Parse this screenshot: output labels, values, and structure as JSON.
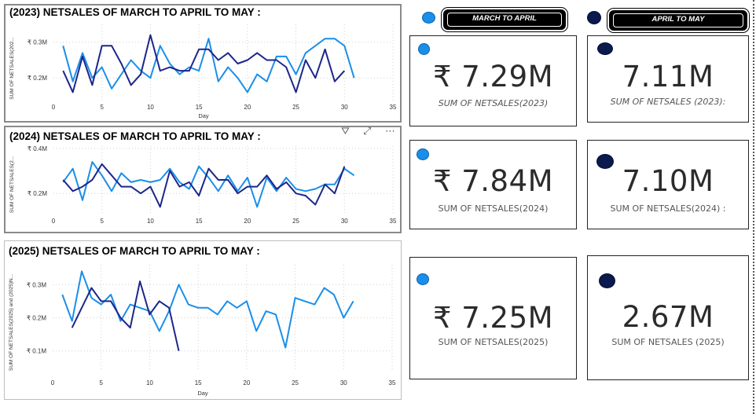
{
  "colors": {
    "light_series": "#1a8fea",
    "dark_series": "#1c2689",
    "dot_light": "#1a8fea",
    "dot_dark": "#0a1a4f"
  },
  "charts": [
    {
      "title": "(2023) NETSALES OF MARCH TO APRIL TO MAY :",
      "ylabel": "SUM OF NETSALES(202...",
      "xlabel": "Day"
    },
    {
      "title": "(2024) NETSALES OF MARCH TO APRIL TO MAY :",
      "ylabel": "SUM OF NETSALES(2...",
      "xlabel": ""
    },
    {
      "title": "(2025) NETSALES OF MARCH TO APRIL TO MAY :",
      "ylabel": "SUM OF NETSALES(2025) and (2025)N...",
      "xlabel": "Day"
    }
  ],
  "chart_data": [
    {
      "type": "line",
      "title": "(2023) NETSALES OF MARCH TO APRIL TO MAY :",
      "xlabel": "Day",
      "ylabel": "SUM OF NETSALES(202...",
      "xlim": [
        0,
        35
      ],
      "ylim": [
        0.13,
        0.35
      ],
      "xticks": [
        0,
        5,
        10,
        15,
        20,
        25,
        30,
        35
      ],
      "yticks": [
        {
          "v": 0.2,
          "label": "₹ 0.2M"
        },
        {
          "v": 0.3,
          "label": "₹ 0.3M"
        }
      ],
      "series": [
        {
          "color": "#1a8fea",
          "x": [
            1,
            2,
            3,
            4,
            5,
            6,
            7,
            8,
            9,
            10,
            11,
            12,
            13,
            14,
            15,
            16,
            17,
            18,
            19,
            20,
            21,
            22,
            23,
            24,
            25,
            26,
            27,
            28,
            29,
            30,
            31
          ],
          "y": [
            0.29,
            0.19,
            0.27,
            0.2,
            0.23,
            0.17,
            0.21,
            0.25,
            0.22,
            0.2,
            0.29,
            0.24,
            0.21,
            0.23,
            0.22,
            0.31,
            0.19,
            0.23,
            0.2,
            0.16,
            0.21,
            0.19,
            0.26,
            0.26,
            0.21,
            0.27,
            0.29,
            0.31,
            0.31,
            0.29,
            0.2
          ]
        },
        {
          "color": "#1c2689",
          "x": [
            1,
            2,
            3,
            4,
            5,
            6,
            7,
            8,
            9,
            10,
            11,
            12,
            13,
            14,
            15,
            16,
            17,
            18,
            19,
            20,
            21,
            22,
            23,
            24,
            25,
            26,
            27,
            28,
            29,
            30
          ],
          "y": [
            0.22,
            0.16,
            0.26,
            0.18,
            0.29,
            0.29,
            0.24,
            0.18,
            0.21,
            0.32,
            0.22,
            0.23,
            0.22,
            0.22,
            0.28,
            0.28,
            0.25,
            0.27,
            0.24,
            0.25,
            0.27,
            0.25,
            0.25,
            0.23,
            0.16,
            0.25,
            0.2,
            0.28,
            0.19,
            0.22
          ]
        }
      ]
    },
    {
      "type": "line",
      "title": "(2024) NETSALES OF MARCH TO APRIL TO MAY :",
      "xlabel": "",
      "ylabel": "SUM OF NETSALES(2...",
      "xlim": [
        0,
        35
      ],
      "ylim": [
        0.11,
        0.41
      ],
      "xticks": [
        0,
        5,
        10,
        15,
        20,
        25,
        30,
        35
      ],
      "yticks": [
        {
          "v": 0.2,
          "label": "₹ 0.2M"
        },
        {
          "v": 0.4,
          "label": "₹ 0.4M"
        }
      ],
      "series": [
        {
          "color": "#1a8fea",
          "x": [
            1,
            2,
            3,
            4,
            5,
            6,
            7,
            8,
            9,
            10,
            11,
            12,
            13,
            14,
            15,
            16,
            17,
            18,
            19,
            20,
            21,
            22,
            23,
            24,
            25,
            26,
            27,
            28,
            29,
            30,
            31
          ],
          "y": [
            0.25,
            0.31,
            0.17,
            0.34,
            0.28,
            0.21,
            0.29,
            0.25,
            0.26,
            0.25,
            0.26,
            0.31,
            0.25,
            0.22,
            0.32,
            0.27,
            0.21,
            0.28,
            0.21,
            0.27,
            0.14,
            0.27,
            0.21,
            0.27,
            0.22,
            0.21,
            0.22,
            0.24,
            0.24,
            0.31,
            0.28
          ]
        },
        {
          "color": "#1c2689",
          "x": [
            1,
            2,
            3,
            4,
            5,
            6,
            7,
            8,
            9,
            10,
            11,
            12,
            13,
            14,
            15,
            16,
            17,
            18,
            19,
            20,
            21,
            22,
            23,
            24,
            25,
            26,
            27,
            28,
            29,
            30
          ],
          "y": [
            0.26,
            0.21,
            0.23,
            0.26,
            0.33,
            0.28,
            0.23,
            0.23,
            0.2,
            0.23,
            0.14,
            0.3,
            0.23,
            0.25,
            0.19,
            0.31,
            0.26,
            0.26,
            0.2,
            0.23,
            0.23,
            0.28,
            0.22,
            0.25,
            0.2,
            0.19,
            0.15,
            0.24,
            0.2,
            0.32
          ]
        }
      ]
    },
    {
      "type": "line",
      "title": "(2025) NETSALES OF MARCH TO APRIL TO MAY :",
      "xlabel": "Day",
      "ylabel": "SUM OF NETSALES(2025) and (2025)N...",
      "xlim": [
        0,
        35
      ],
      "ylim": [
        0.04,
        0.36
      ],
      "xticks": [
        0,
        5,
        10,
        15,
        20,
        25,
        30,
        35
      ],
      "yticks": [
        {
          "v": 0.1,
          "label": "₹ 0.1M"
        },
        {
          "v": 0.2,
          "label": "₹ 0.2M"
        },
        {
          "v": 0.3,
          "label": "₹ 0.3M"
        }
      ],
      "series": [
        {
          "color": "#1a8fea",
          "x": [
            1,
            2,
            3,
            4,
            5,
            6,
            7,
            8,
            9,
            10,
            11,
            12,
            13,
            14,
            15,
            16,
            17,
            18,
            19,
            20,
            21,
            22,
            23,
            24,
            25,
            26,
            27,
            28,
            29,
            30,
            31
          ],
          "y": [
            0.27,
            0.19,
            0.34,
            0.26,
            0.24,
            0.27,
            0.19,
            0.24,
            0.23,
            0.22,
            0.16,
            0.22,
            0.3,
            0.24,
            0.23,
            0.23,
            0.21,
            0.25,
            0.23,
            0.25,
            0.16,
            0.22,
            0.21,
            0.11,
            0.26,
            0.25,
            0.24,
            0.29,
            0.27,
            0.2,
            0.25
          ]
        },
        {
          "color": "#1c2689",
          "x": [
            2,
            3,
            4,
            5,
            6,
            7,
            8,
            9,
            10,
            11,
            12,
            13
          ],
          "y": [
            0.17,
            0.23,
            0.29,
            0.25,
            0.25,
            0.2,
            0.17,
            0.31,
            0.21,
            0.25,
            0.23,
            0.1
          ]
        }
      ]
    }
  ],
  "headers": {
    "march_april": "MARCH TO APRIL",
    "april_may": "APRIL TO MAY"
  },
  "cards": [
    {
      "value": "₹ 7.29M",
      "label": "SUM OF NETSALES(2023)"
    },
    {
      "value": "7.11M",
      "label": "SUM OF  NETSALES (2023):"
    },
    {
      "value": "₹ 7.84M",
      "label": "SUM OF NETSALES(2024)"
    },
    {
      "value": "7.10M",
      "label": "SUM OF NETSALES(2024) :"
    },
    {
      "value": "₹ 7.25M",
      "label": "SUM OF NETSALES(2025)"
    },
    {
      "value": "2.67M",
      "label": "SUM OF NETSALES (2025)"
    }
  ],
  "visual_header_icons": [
    "filter-icon",
    "focus-mode-icon",
    "more-options-icon"
  ]
}
